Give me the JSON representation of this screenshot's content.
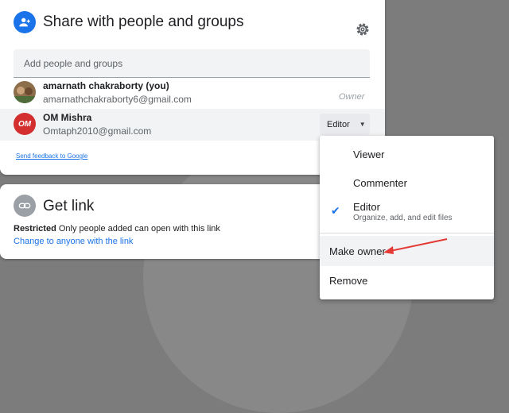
{
  "share": {
    "title": "Share with people and groups",
    "add_placeholder": "Add people and groups",
    "people": [
      {
        "name": "amarnath chakraborty (you)",
        "email": "amarnathchakraborty6@gmail.com",
        "role": "Owner"
      },
      {
        "name": "OM Mishra",
        "email": "Omtaph2010@gmail.com",
        "role": "Editor",
        "avatar_text": "OM"
      }
    ],
    "feedback_link": "Send feedback to Google"
  },
  "link": {
    "title": "Get link",
    "restriction": "Restricted",
    "restriction_desc": "Only people added can open with this link",
    "change_link": "Change to anyone with the link"
  },
  "role_menu": {
    "items": [
      {
        "label": "Viewer"
      },
      {
        "label": "Commenter"
      },
      {
        "label": "Editor",
        "desc": "Organize, add, and edit files",
        "selected": true
      }
    ],
    "make_owner": "Make owner",
    "remove": "Remove"
  },
  "colors": {
    "accent": "#1a73e8",
    "annotation_arrow": "#e53935",
    "avatar_red": "#d32f2f"
  }
}
